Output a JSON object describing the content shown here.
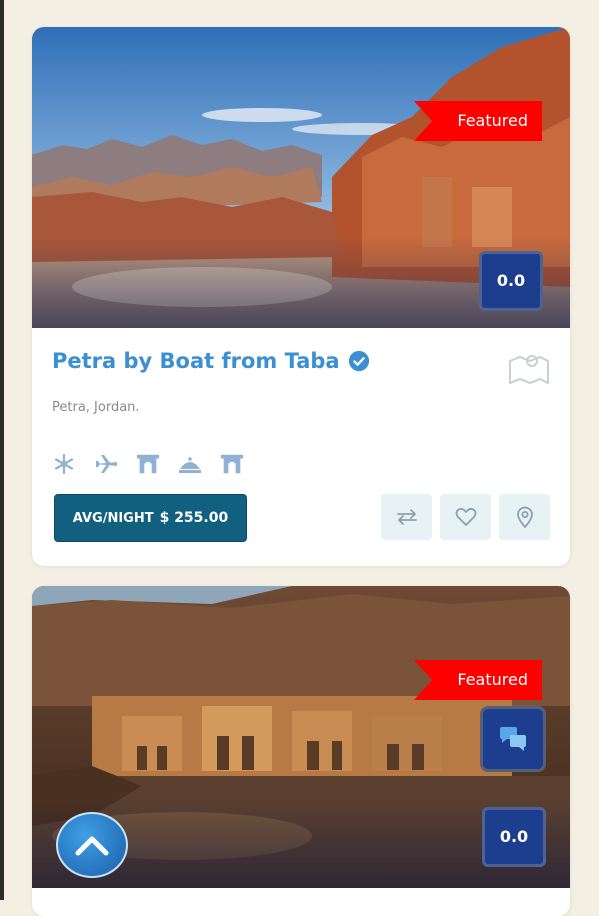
{
  "listings": [
    {
      "title": "Petra by Boat from Taba",
      "location": "Petra, Jordan.",
      "badge": "Featured",
      "score": "0.0",
      "price_label": "AVG/NIGHT",
      "price": "$ 255.00",
      "amenities": [
        "snowflake-icon",
        "plane-icon",
        "archway-icon",
        "dome-icon",
        "archway-icon"
      ],
      "actions": [
        "compare-icon",
        "heart-icon",
        "map-marker-icon"
      ]
    },
    {
      "badge": "Featured",
      "score": "0.0"
    }
  ],
  "colors": {
    "title": "#3b8fd3",
    "ribbon": "#ff0000",
    "score_bg": "#1d3e8e",
    "price_bg": "#11607f",
    "action_bg": "#e7f2f4",
    "page_bg": "#f3efe2"
  }
}
